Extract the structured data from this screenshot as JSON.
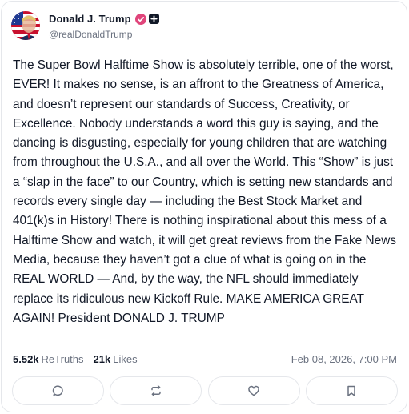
{
  "author": {
    "display_name": "Donald J. Trump",
    "handle": "@realDonaldTrump",
    "avatar_icon": "avatar-flag-portrait",
    "verified_icon": "verified-badge-icon",
    "extra_badge_icon": "plus-badge-icon"
  },
  "post": {
    "text": "The Super Bowl Halftime Show is absolutely terrible, one of the worst, EVER! It makes no sense, is an affront to the Greatness of America, and doesn’t represent our standards of Success, Creativity, or Excellence. Nobody understands a word this guy is saying, and the dancing is disgusting, especially for young children that are watching from throughout the U.S.A., and all over the World. This “Show” is just a “slap in the face” to our Country, which is setting new standards and records every single day — including the Best Stock Market and 401(k)s in History! There is nothing inspirational about this mess of a Halftime Show and watch, it will get great reviews from the Fake News Media, because they haven’t got a clue of what is going on in the REAL WORLD — And, by the way, the NFL should immediately replace its ridiculous new Kickoff Rule. MAKE AMERICA GREAT AGAIN! President DONALD J. TRUMP"
  },
  "stats": {
    "retruths_count": "5.52k",
    "retruths_label": "ReTruths",
    "likes_count": "21k",
    "likes_label": "Likes",
    "timestamp": "Feb 08, 2026, 7:00 PM"
  },
  "actions": [
    {
      "icon": "reply-icon"
    },
    {
      "icon": "retruth-icon"
    },
    {
      "icon": "like-heart-icon"
    },
    {
      "icon": "bookmark-icon"
    }
  ],
  "colors": {
    "verified_badge": "#e0457b",
    "text_primary": "#111827",
    "text_secondary": "#6b7280",
    "border": "#e5e7eb",
    "icon_gray": "#6b7280"
  }
}
